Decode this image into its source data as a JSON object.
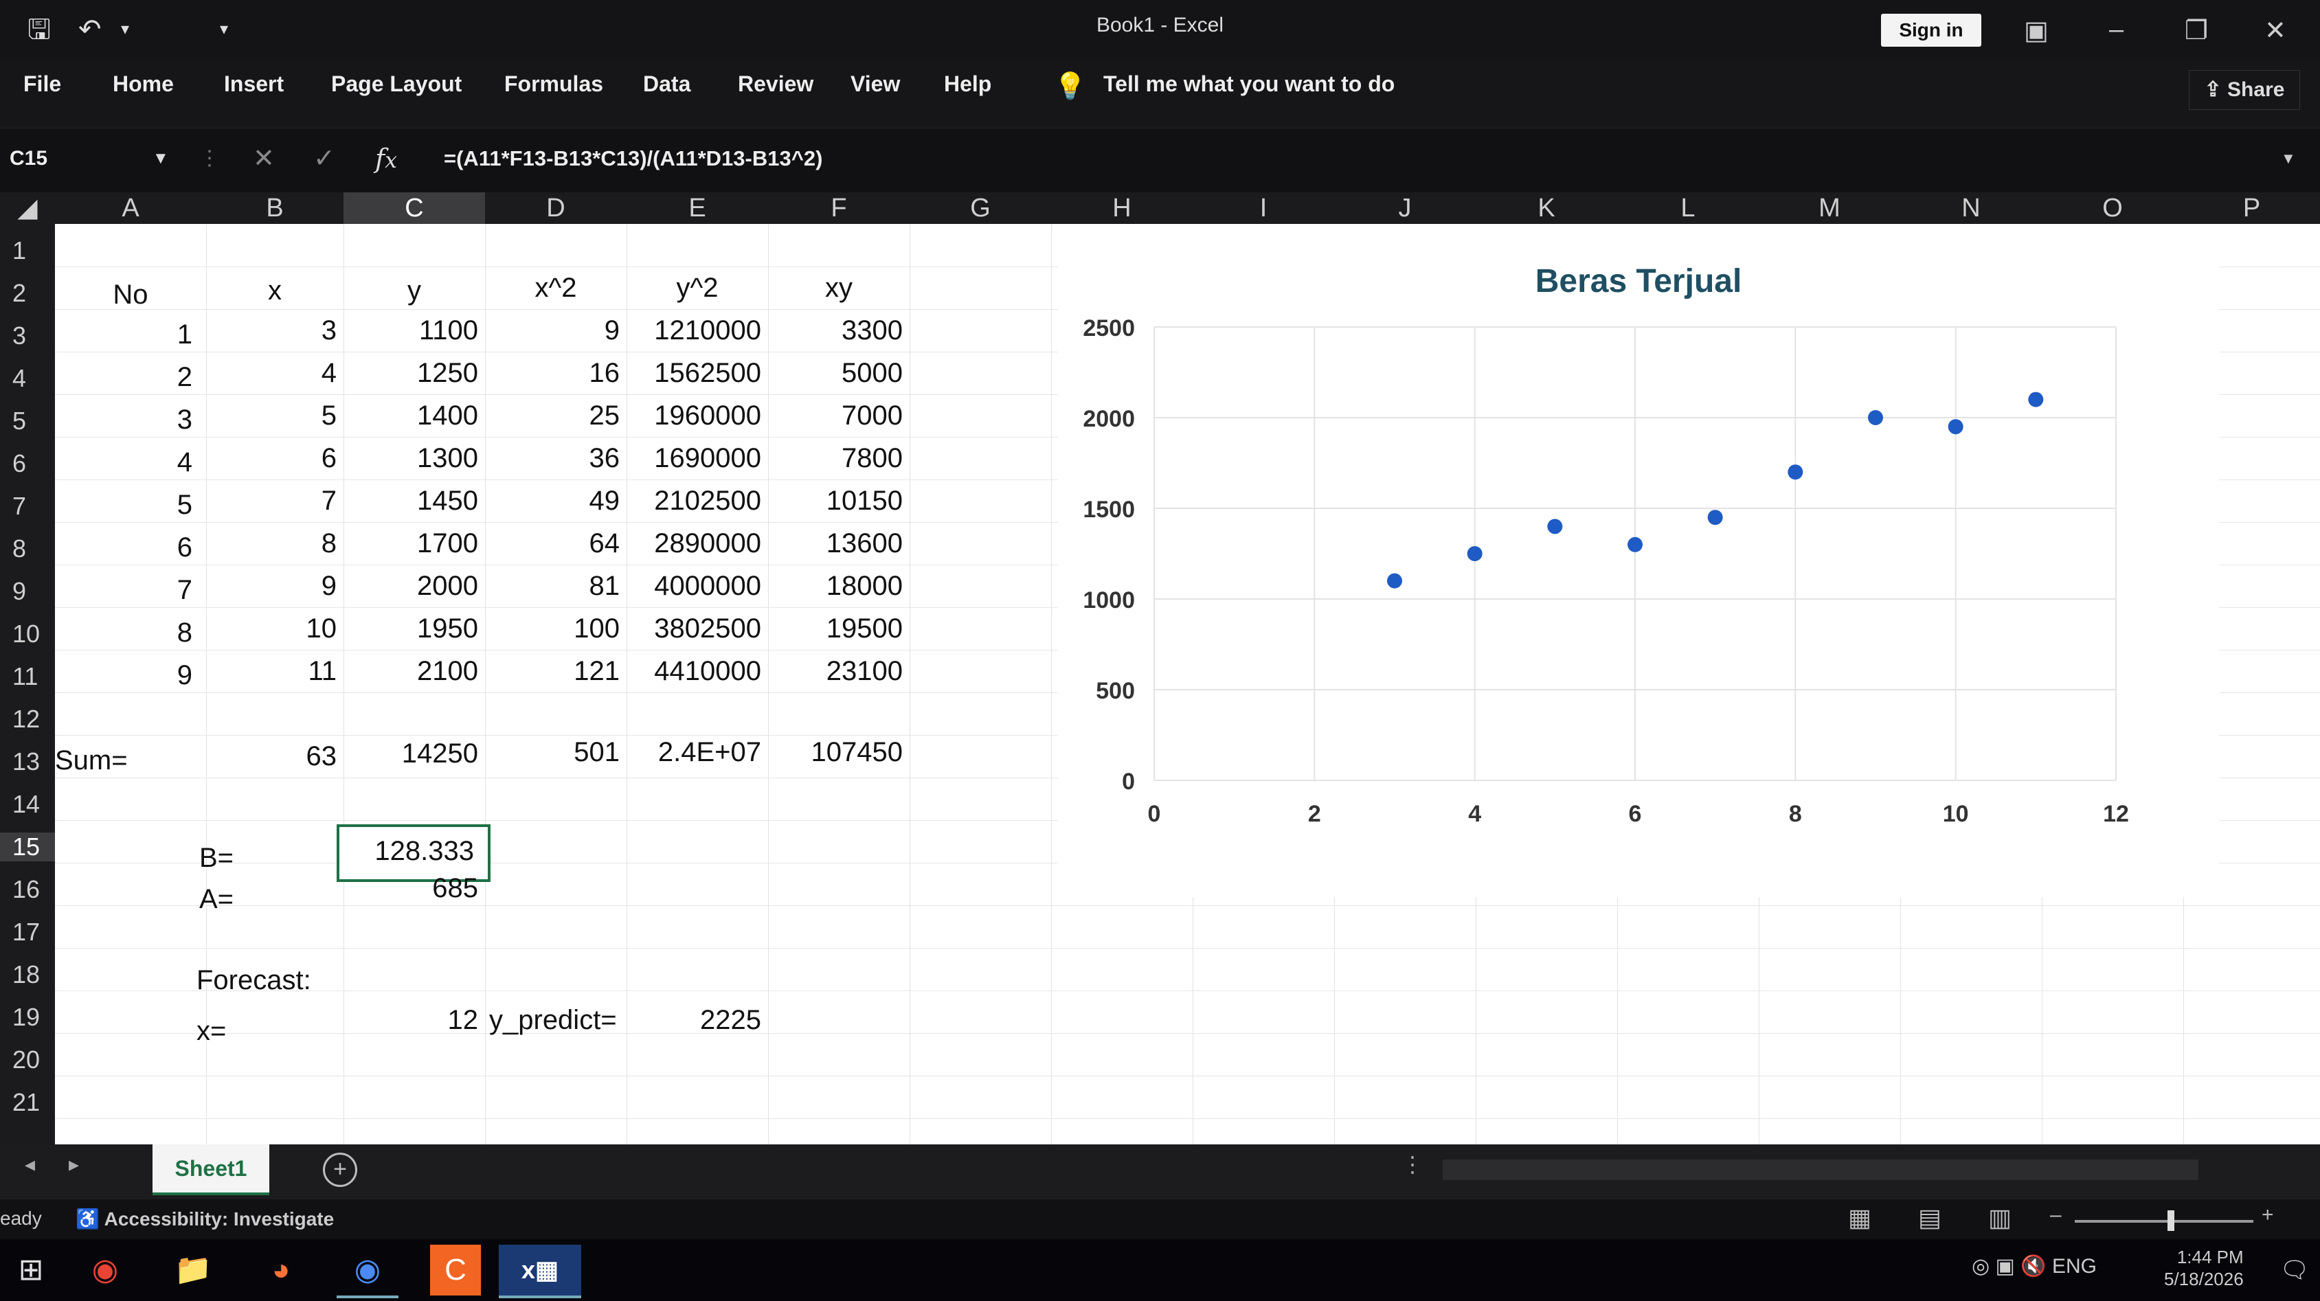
{
  "titlebar": {
    "save_icon": "save-icon",
    "undo_icon": "undo-icon",
    "title": "Book1 - Excel",
    "signin": "Sign in"
  },
  "ribbon": {
    "tabs": [
      "File",
      "Home",
      "Insert",
      "Page Layout",
      "Formulas",
      "Data",
      "Review",
      "View",
      "Help"
    ],
    "tell_me": "Tell me what you want to do",
    "share": "Share"
  },
  "formula_bar": {
    "name_box": "C15",
    "formula": "=(A11*F13-B13*C13)/(A11*D13-B13^2)"
  },
  "columns": [
    "A",
    "B",
    "C",
    "D",
    "E",
    "F",
    "G",
    "H",
    "I",
    "J",
    "K",
    "L",
    "M",
    "N",
    "O",
    "P"
  ],
  "rows": [
    "1",
    "2",
    "3",
    "4",
    "5",
    "6",
    "7",
    "8",
    "9",
    "10",
    "11",
    "12",
    "13",
    "14",
    "15",
    "16",
    "17",
    "18",
    "19",
    "20",
    "21"
  ],
  "sheet": {
    "headers": {
      "no": "No",
      "x": "x",
      "y": "y",
      "x2": "x^2",
      "y2": "y^2",
      "xy": "xy"
    },
    "data_rows": [
      {
        "no": "1",
        "x": "3",
        "y": "1100",
        "x2": "9",
        "y2": "1210000",
        "xy": "3300"
      },
      {
        "no": "2",
        "x": "4",
        "y": "1250",
        "x2": "16",
        "y2": "1562500",
        "xy": "5000"
      },
      {
        "no": "3",
        "x": "5",
        "y": "1400",
        "x2": "25",
        "y2": "1960000",
        "xy": "7000"
      },
      {
        "no": "4",
        "x": "6",
        "y": "1300",
        "x2": "36",
        "y2": "1690000",
        "xy": "7800"
      },
      {
        "no": "5",
        "x": "7",
        "y": "1450",
        "x2": "49",
        "y2": "2102500",
        "xy": "10150"
      },
      {
        "no": "6",
        "x": "8",
        "y": "1700",
        "x2": "64",
        "y2": "2890000",
        "xy": "13600"
      },
      {
        "no": "7",
        "x": "9",
        "y": "2000",
        "x2": "81",
        "y2": "4000000",
        "xy": "18000"
      },
      {
        "no": "8",
        "x": "10",
        "y": "1950",
        "x2": "100",
        "y2": "3802500",
        "xy": "19500"
      },
      {
        "no": "9",
        "x": "11",
        "y": "2100",
        "x2": "121",
        "y2": "4410000",
        "xy": "23100"
      }
    ],
    "sum_label": "Sum=",
    "sum": {
      "x": "63",
      "y": "14250",
      "x2": "501",
      "y2": "2.4E+07",
      "xy": "107450"
    },
    "b_label": "B=",
    "b_value": "128.333",
    "a_label": "A=",
    "a_value": "685",
    "forecast_label": "Forecast:",
    "x_label": "x=",
    "x_value": "12",
    "ypred_label": "y_predict=",
    "ypred_value": "2225"
  },
  "chart_data": {
    "type": "scatter",
    "title": "Beras Terjual",
    "x": [
      3,
      4,
      5,
      6,
      7,
      8,
      9,
      10,
      11
    ],
    "y": [
      1100,
      1250,
      1400,
      1300,
      1450,
      1700,
      2000,
      1950,
      2100
    ],
    "xlim": [
      0,
      12
    ],
    "ylim": [
      0,
      2500
    ],
    "xticks": [
      "0",
      "2",
      "4",
      "6",
      "8",
      "10",
      "12"
    ],
    "yticks": [
      "0",
      "500",
      "1000",
      "1500",
      "2000",
      "2500"
    ],
    "grid": true,
    "marker_color": "#1f5bc4"
  },
  "sheet_tabs": {
    "active": "Sheet1"
  },
  "status": {
    "ready": "eady",
    "accessibility": "Accessibility: Investigate"
  },
  "taskbar": {
    "apps": [
      "chrome-icon",
      "file-explorer-icon",
      "firefox-icon",
      "chrome-icon",
      "app-icon",
      "excel-icon"
    ],
    "lang": "ENG",
    "time": "1:44 PM",
    "date": "5/18/2026"
  }
}
